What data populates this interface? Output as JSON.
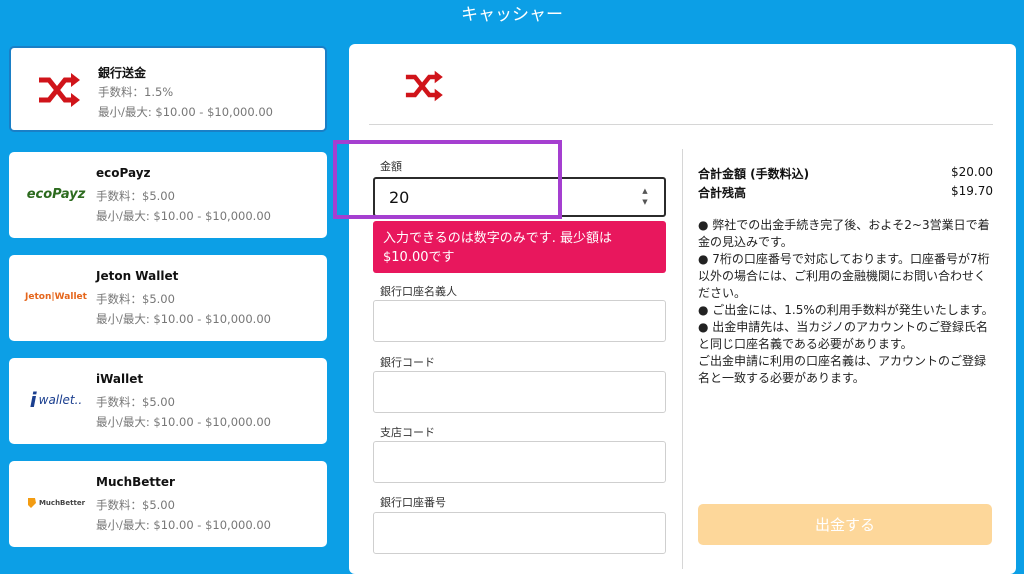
{
  "header": {
    "title": "キャッシャー"
  },
  "methods": [
    {
      "name": "銀行送金",
      "fee": "手数料：1.5%",
      "range": "最小/最大: $10.00 - $10,000.00"
    },
    {
      "name": "ecoPayz",
      "fee": "手数料：$5.00",
      "range": "最小/最大: $10.00 - $10,000.00",
      "logo_text": "ecoPayz"
    },
    {
      "name": "Jeton Wallet",
      "fee": "手数料：$5.00",
      "range": "最小/最大: $10.00 - $10,000.00",
      "logo_text": "Jeton|Wallet"
    },
    {
      "name": "iWallet",
      "fee": "手数料：$5.00",
      "range": "最小/最大: $10.00 - $10,000.00",
      "logo_text": "wallet.."
    },
    {
      "name": "MuchBetter",
      "fee": "手数料：$5.00",
      "range": "最小/最大: $10.00 - $10,000.00",
      "logo_text": "MuchBetter"
    }
  ],
  "form": {
    "amount_label": "金額",
    "amount_value": "20",
    "error": "入力できるのは数字のみです. 最少額は $10.00です",
    "holder_label": "銀行口座名義人",
    "bank_code_label": "銀行コード",
    "branch_code_label": "支店コード",
    "account_number_label": "銀行口座番号"
  },
  "summary": {
    "total_label": "合計金額 (手数料込)",
    "total_value": "$20.00",
    "balance_label": "合計残高",
    "balance_value": "$19.70"
  },
  "notes": [
    "● 弊社での出金手続き完了後、およそ2~3営業日で着金の見込みです。",
    "● 7桁の口座番号で対応しております。口座番号が7桁以外の場合には、ご利用の金融機関にお問い合わせください。",
    "● ご出金には、1.5%の利用手数料が発生いたします。",
    "● 出金申請先は、当カジノのアカウントのご登録氏名と同じ口座名義である必要があります。",
    "ご出金申請に利用の口座名義は、アカウントのご登録名と一致する必要があります。"
  ],
  "submit_label": "出金する",
  "colors": {
    "background": "#0c9fe6",
    "error": "#e8175d",
    "highlight": "#a53fd0",
    "submit": "#fdd79a",
    "bank_icon": "#d0141a"
  }
}
